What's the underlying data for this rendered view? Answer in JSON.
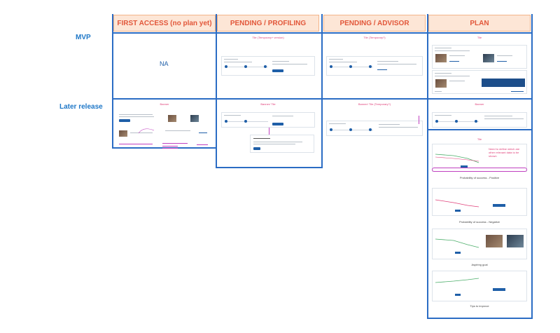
{
  "columns": [
    {
      "label": "FIRST ACCESS (no plan yet)"
    },
    {
      "label": "PENDING / PROFILING"
    },
    {
      "label": "PENDING / ADVISOR"
    },
    {
      "label": "PLAN"
    }
  ],
  "rows": [
    {
      "label": "MVP"
    },
    {
      "label": "Later release"
    }
  ],
  "mvp": {
    "first_access": "NA",
    "profiling_title": "Tile (Temporary+ version)",
    "advisor_title": "Tile (Temporary?)",
    "plan_title": "Tile"
  },
  "later": {
    "first_access_title": "Banner",
    "profiling_title": "Banner/ Tile",
    "advisor_title": "Banner/ Tile (Temporary?)",
    "plan_title": "Banner"
  },
  "plan_extra": {
    "tile_label": "Tile",
    "note": "Need to define which are other relevant data to be shown",
    "caption_positive": "Probability of success - Positive",
    "caption_negative": "Probability of success - Negative",
    "caption_goal": "Aspiring goal",
    "caption_tips": "Tips to improve"
  }
}
